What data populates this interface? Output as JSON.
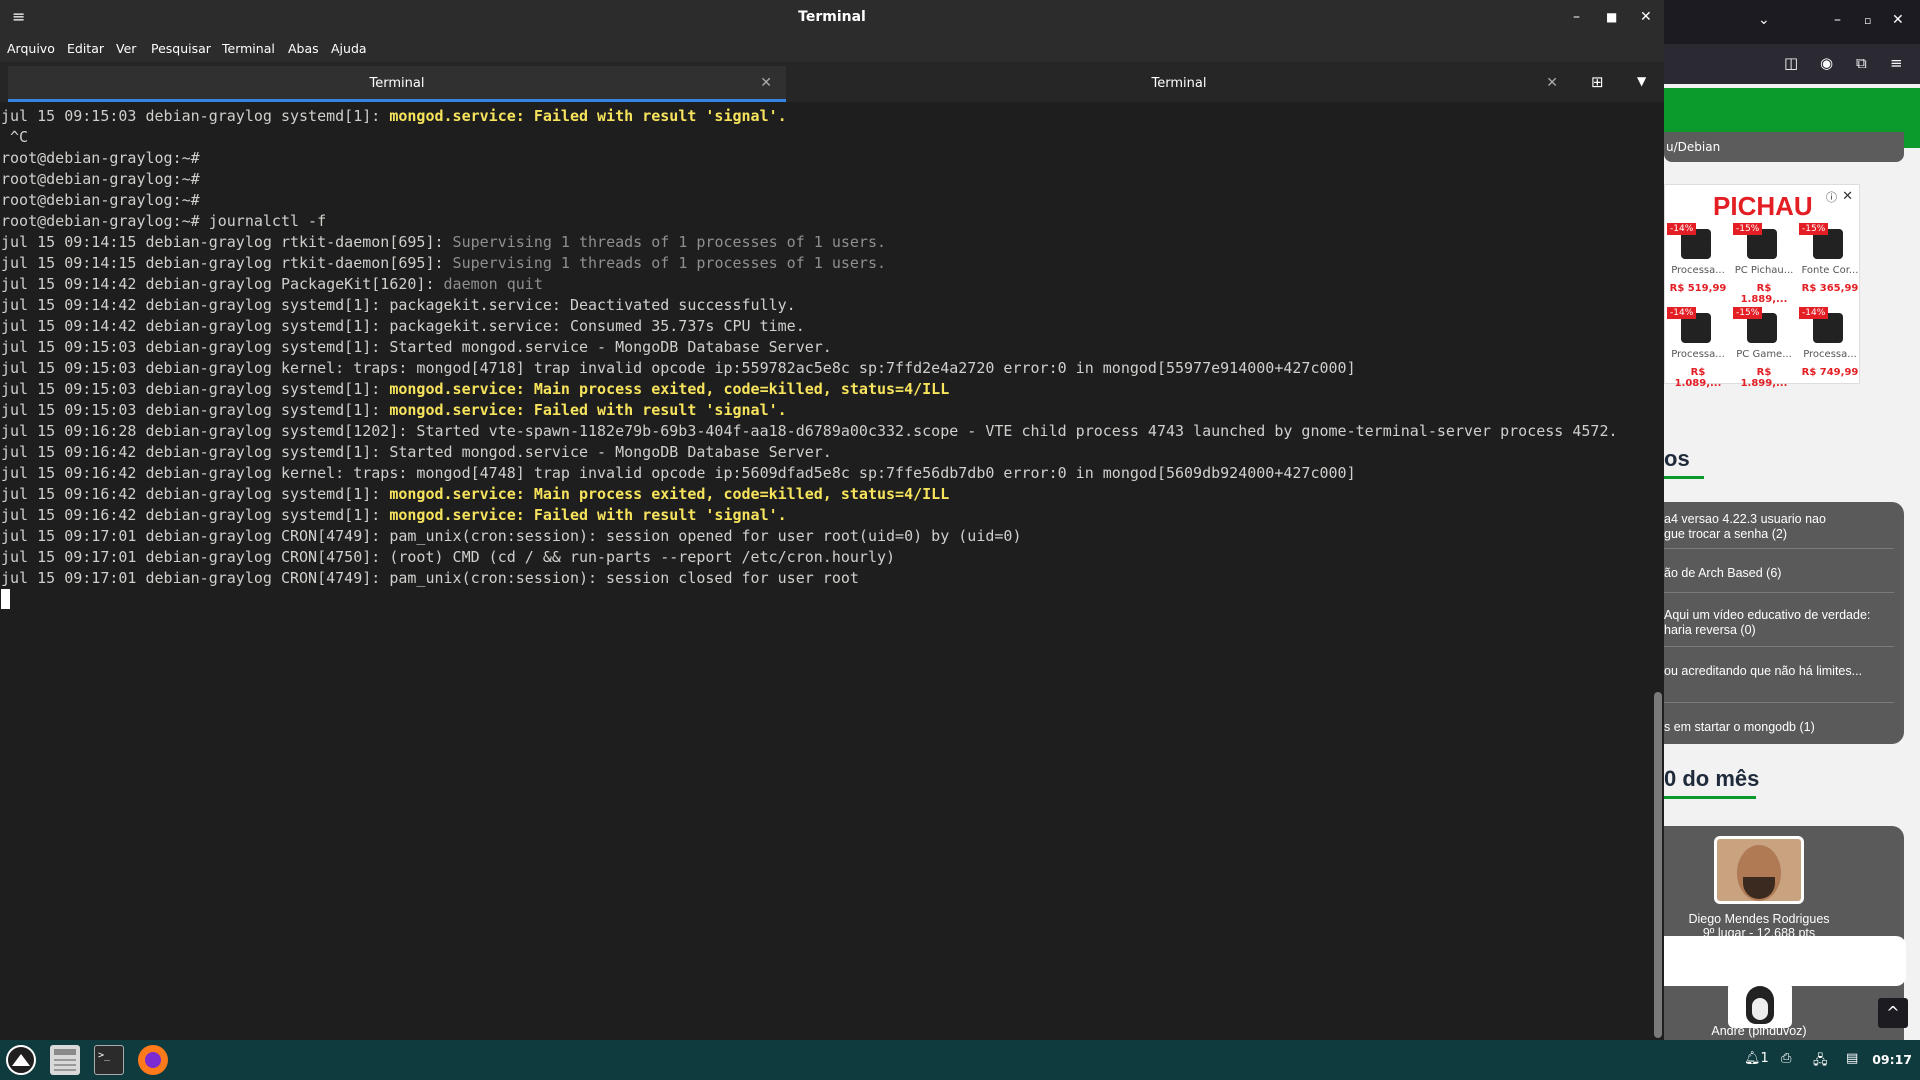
{
  "terminal": {
    "title": "Terminal",
    "menu": [
      "Arquivo",
      "Editar",
      "Ver",
      "Pesquisar",
      "Terminal",
      "Abas",
      "Ajuda"
    ],
    "tabs": [
      {
        "label": "Terminal",
        "active": true
      },
      {
        "label": "Terminal",
        "active": false
      }
    ],
    "lines": [
      [
        {
          "t": "jul 15 09:15:03 debian-graylog systemd[1]: "
        },
        {
          "t": "mongod.service: Failed with result 'signal'.",
          "c": "hl"
        }
      ],
      [
        {
          "t": " ^C"
        }
      ],
      [
        {
          "t": "root@debian-graylog:~#"
        }
      ],
      [
        {
          "t": "root@debian-graylog:~#"
        }
      ],
      [
        {
          "t": "root@debian-graylog:~#"
        }
      ],
      [
        {
          "t": "root@debian-graylog:~# journalctl -f"
        }
      ],
      [
        {
          "t": "jul 15 09:14:15 debian-graylog rtkit-daemon[695]: "
        },
        {
          "t": "Supervising 1 threads of 1 processes of 1 users.",
          "c": "dim"
        }
      ],
      [
        {
          "t": "jul 15 09:14:15 debian-graylog rtkit-daemon[695]: "
        },
        {
          "t": "Supervising 1 threads of 1 processes of 1 users.",
          "c": "dim"
        }
      ],
      [
        {
          "t": "jul 15 09:14:42 debian-graylog PackageKit[1620]: "
        },
        {
          "t": "daemon quit",
          "c": "dim"
        }
      ],
      [
        {
          "t": "jul 15 09:14:42 debian-graylog systemd[1]: packagekit.service: Deactivated successfully."
        }
      ],
      [
        {
          "t": "jul 15 09:14:42 debian-graylog systemd[1]: packagekit.service: Consumed 35.737s CPU time."
        }
      ],
      [
        {
          "t": "jul 15 09:15:03 debian-graylog systemd[1]: Started mongod.service - MongoDB Database Server."
        }
      ],
      [
        {
          "t": "jul 15 09:15:03 debian-graylog kernel: traps: mongod[4718] trap invalid opcode ip:559782ac5e8c sp:7ffd2e4a2720 error:0 in mongod[55977e914000+427c000]"
        }
      ],
      [
        {
          "t": "jul 15 09:15:03 debian-graylog systemd[1]: "
        },
        {
          "t": "mongod.service: Main process exited, code=killed, status=4/ILL",
          "c": "hl"
        }
      ],
      [
        {
          "t": "jul 15 09:15:03 debian-graylog systemd[1]: "
        },
        {
          "t": "mongod.service: Failed with result 'signal'.",
          "c": "hl"
        }
      ],
      [
        {
          "t": "jul 15 09:16:28 debian-graylog systemd[1202]: Started vte-spawn-1182e79b-69b3-404f-aa18-d6789a00c332.scope - VTE child process 4743 launched by gnome-terminal-server process 4572."
        }
      ],
      [
        {
          "t": "jul 15 09:16:42 debian-graylog systemd[1]: Started mongod.service - MongoDB Database Server."
        }
      ],
      [
        {
          "t": "jul 15 09:16:42 debian-graylog kernel: traps: mongod[4748] trap invalid opcode ip:5609dfad5e8c sp:7ffe56db7db0 error:0 in mongod[5609db924000+427c000]"
        }
      ],
      [
        {
          "t": "jul 15 09:16:42 debian-graylog systemd[1]: "
        },
        {
          "t": "mongod.service: Main process exited, code=killed, status=4/ILL",
          "c": "hl"
        }
      ],
      [
        {
          "t": "jul 15 09:16:42 debian-graylog systemd[1]: "
        },
        {
          "t": "mongod.service: Failed with result 'signal'.",
          "c": "hl"
        }
      ],
      [
        {
          "t": "jul 15 09:17:01 debian-graylog CRON[4749]: pam_unix(cron:session): session opened for user root(uid=0) by (uid=0)"
        }
      ],
      [
        {
          "t": "jul 15 09:17:01 debian-graylog CRON[4750]: (root) CMD (cd / && run-parts --report /etc/cron.hourly)"
        }
      ],
      [
        {
          "t": "jul 15 09:17:01 debian-graylog CRON[4749]: pam_unix(cron:session): session closed for user root"
        }
      ]
    ],
    "colors": {
      "highlight": "#f7e45c",
      "dim": "#8f8f8f",
      "text": "#d0cfcc",
      "tab_accent": "#3584e4"
    }
  },
  "browser": {
    "breadcrumb": "u/Debian",
    "ad": {
      "brand": "PICHAU",
      "products": [
        {
          "discount": "-14%",
          "name": "Processa...",
          "price": "R$ 519,99"
        },
        {
          "discount": "-15%",
          "name": "PC Pichau...",
          "price": "R$ 1.889,..."
        },
        {
          "discount": "-15%",
          "name": "Fonte Cor...",
          "price": "R$ 365,99"
        },
        {
          "discount": "-14%",
          "name": "Processa...",
          "price": "R$ 1.089,..."
        },
        {
          "discount": "-15%",
          "name": "PC Game...",
          "price": "R$ 1.899,..."
        },
        {
          "discount": "-14%",
          "name": "Processa...",
          "price": "R$ 749,99"
        }
      ]
    },
    "topics_heading": "os",
    "topics": [
      "a4 versao 4.22.3 usuario nao\ngue trocar a senha (2)",
      "ão de Arch Based (6)",
      " Aqui um vídeo educativo de verdade:\nharia reversa (0)",
      "ou acreditando que não há limites...",
      "s em startar o mongodb (1)"
    ],
    "top_heading": "0 do mês",
    "users": [
      {
        "name": "Diego Mendes Rodrigues",
        "rank": "9º lugar - 12.688 pts"
      },
      {
        "name": "Andre (pinduvoz)"
      }
    ],
    "brand_green": "#0a9b2c"
  },
  "taskbar": {
    "clock": "09:17",
    "notification_count": "1",
    "icons": [
      "launcher-icon",
      "files-icon",
      "terminal-icon",
      "firefox-icon"
    ]
  }
}
